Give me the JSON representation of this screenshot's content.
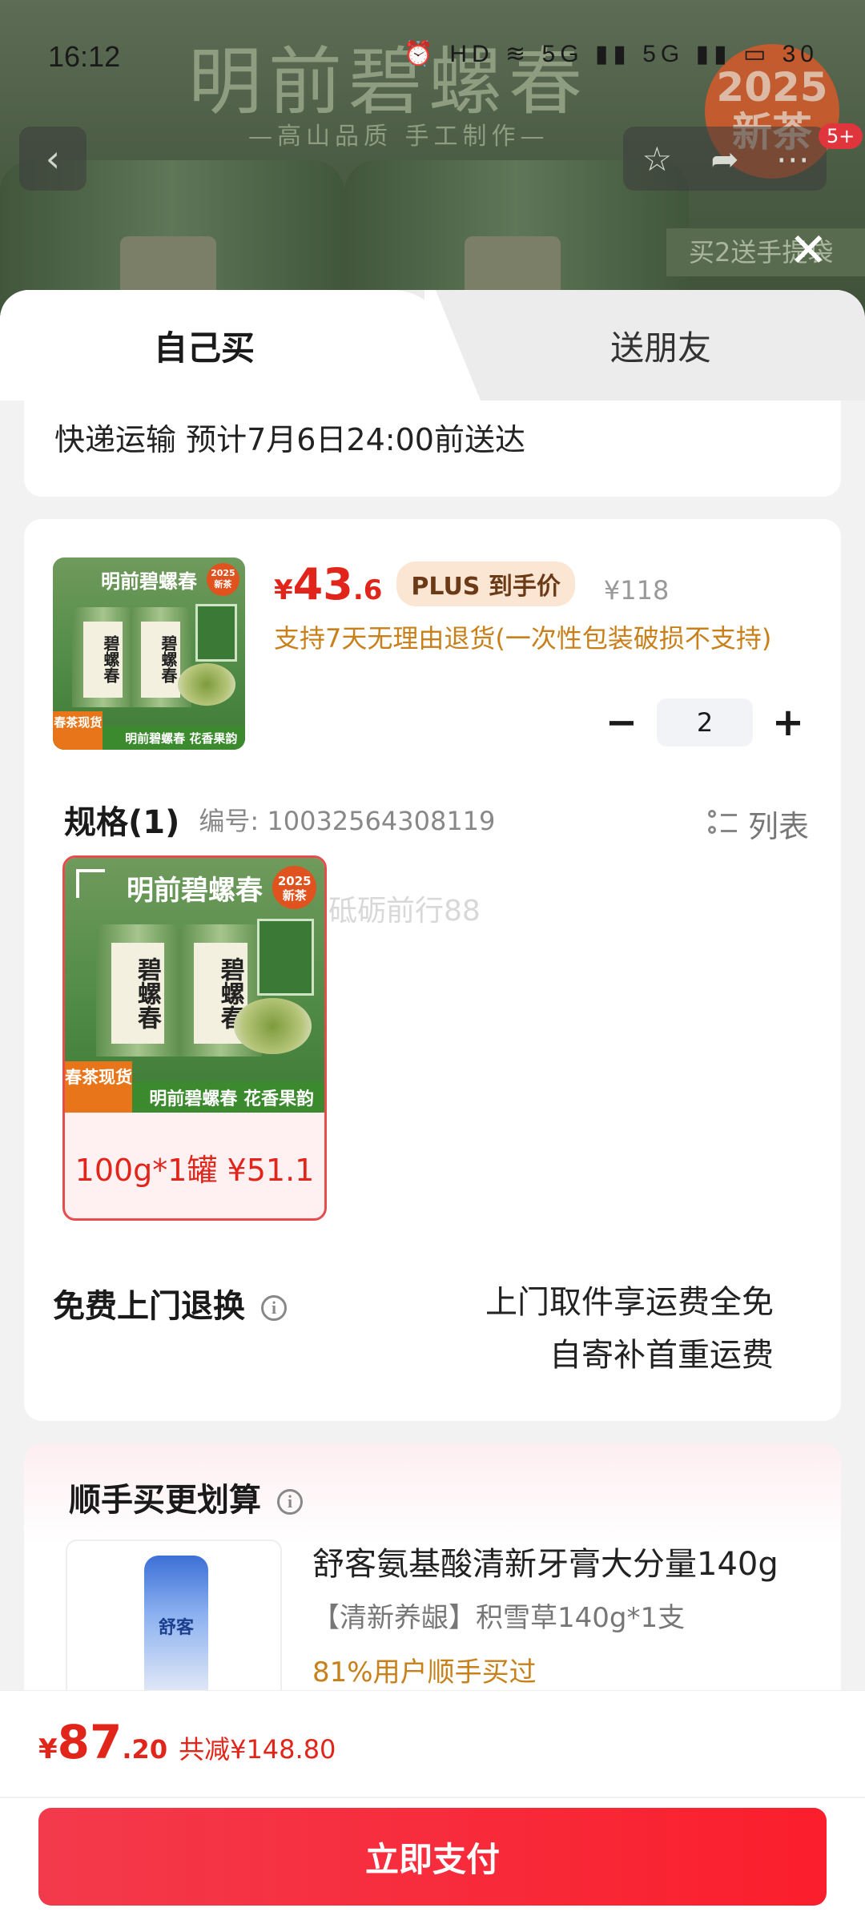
{
  "status_bar": {
    "time": "16:12",
    "icons": "⏰ HD ≋ 5G ▮▮ 5G ▮▮ ▭ 30"
  },
  "banner": {
    "title": "明前碧螺春",
    "subtitle": "—高山品质  手工制作—",
    "badge": "2025\n新茶",
    "gift_text": "买2送手提袋",
    "cart_count": "5+"
  },
  "tabs": {
    "self": "自己买",
    "friend": "送朋友"
  },
  "shipping": {
    "text": "快递运输 预计7月6日24:00前送达"
  },
  "product": {
    "price_symbol": "¥",
    "price_int": "43",
    "price_dec": ".6",
    "plus_tag": "PLUS 到手价",
    "original_price": "¥118",
    "return_note": "支持7天无理由退货(一次性包装破损不支持)",
    "quantity": "2",
    "image": {
      "title": "明前碧螺春",
      "can_label": "碧螺春",
      "badge": "2025新茶",
      "strip": "明前碧螺春 花香果韵",
      "orange": "春茶现货"
    }
  },
  "spec": {
    "title": "规格(1)",
    "code": "编号: 10032564308119",
    "list_label": "列表",
    "option_label": "100g*1罐 ¥51.1",
    "watermark": "砥砺前行88"
  },
  "free_return": {
    "title": "免费上门退换",
    "line1": "上门取件享运费全免",
    "line2": "自寄补首重运费"
  },
  "addon": {
    "title": "顺手买更划算",
    "name": "舒客氨基酸清新牙膏大分量140g",
    "spec": "【清新养龈】积雪草140g*1支",
    "rate": "81%用户顺手买过",
    "brand": "舒客"
  },
  "bottom": {
    "symbol": "¥",
    "int": "87",
    "dec": ".20",
    "saving": "共减¥148.80",
    "pay_label": "立即支付"
  },
  "colors": {
    "accent": "#e1251b",
    "orange_text": "#c8801a",
    "pay_button": "#f33a4c"
  }
}
